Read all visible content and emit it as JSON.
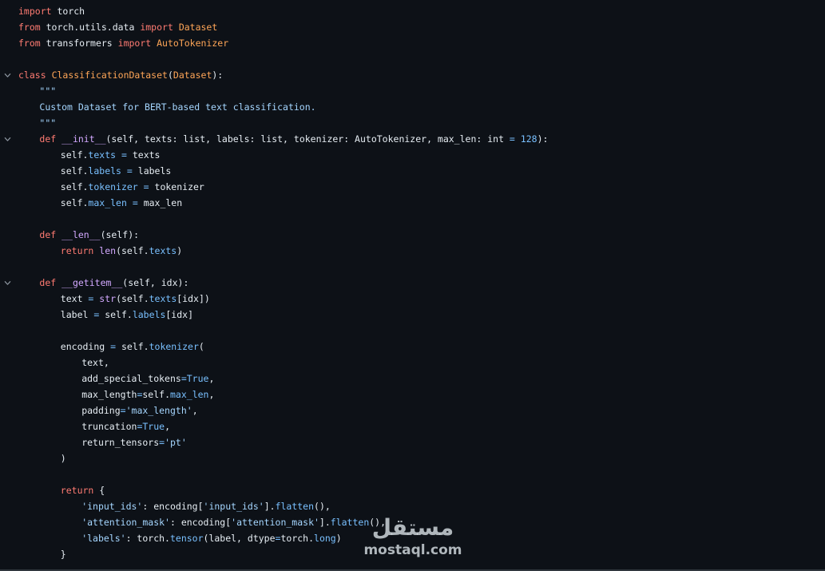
{
  "editor": {
    "lines": [
      {
        "fold": false,
        "indent": 0,
        "tokens": [
          [
            "kw",
            "import"
          ],
          [
            "plain",
            " torch"
          ]
        ]
      },
      {
        "fold": false,
        "indent": 0,
        "tokens": [
          [
            "kw",
            "from"
          ],
          [
            "plain",
            " torch.utils.data "
          ],
          [
            "kw",
            "import"
          ],
          [
            "plain",
            " "
          ],
          [
            "cls",
            "Dataset"
          ]
        ]
      },
      {
        "fold": false,
        "indent": 0,
        "tokens": [
          [
            "kw",
            "from"
          ],
          [
            "plain",
            " transformers "
          ],
          [
            "kw",
            "import"
          ],
          [
            "plain",
            " "
          ],
          [
            "cls",
            "AutoTokenizer"
          ]
        ]
      },
      {
        "fold": false,
        "indent": 0,
        "tokens": []
      },
      {
        "fold": true,
        "indent": 0,
        "tokens": [
          [
            "kw",
            "class"
          ],
          [
            "plain",
            " "
          ],
          [
            "cls",
            "ClassificationDataset"
          ],
          [
            "plain",
            "("
          ],
          [
            "cls",
            "Dataset"
          ],
          [
            "plain",
            "):"
          ]
        ]
      },
      {
        "fold": false,
        "indent": 1,
        "tokens": [
          [
            "str",
            "\"\"\""
          ]
        ]
      },
      {
        "fold": false,
        "indent": 1,
        "tokens": [
          [
            "str",
            "Custom Dataset for BERT-based text classification."
          ]
        ]
      },
      {
        "fold": false,
        "indent": 1,
        "tokens": [
          [
            "str",
            "\"\"\""
          ]
        ]
      },
      {
        "fold": true,
        "indent": 1,
        "tokens": [
          [
            "kw",
            "def"
          ],
          [
            "plain",
            " "
          ],
          [
            "fn",
            "__init__"
          ],
          [
            "plain",
            "(self, texts: list, labels: list, tokenizer: AutoTokenizer, max_len: int "
          ],
          [
            "op",
            "="
          ],
          [
            "plain",
            " "
          ],
          [
            "num",
            "128"
          ],
          [
            "plain",
            "):"
          ]
        ]
      },
      {
        "fold": false,
        "indent": 2,
        "tokens": [
          [
            "plain",
            "self."
          ],
          [
            "attr",
            "texts"
          ],
          [
            "plain",
            " "
          ],
          [
            "op",
            "="
          ],
          [
            "plain",
            " texts"
          ]
        ]
      },
      {
        "fold": false,
        "indent": 2,
        "tokens": [
          [
            "plain",
            "self."
          ],
          [
            "attr",
            "labels"
          ],
          [
            "plain",
            " "
          ],
          [
            "op",
            "="
          ],
          [
            "plain",
            " labels"
          ]
        ]
      },
      {
        "fold": false,
        "indent": 2,
        "tokens": [
          [
            "plain",
            "self."
          ],
          [
            "attr",
            "tokenizer"
          ],
          [
            "plain",
            " "
          ],
          [
            "op",
            "="
          ],
          [
            "plain",
            " tokenizer"
          ]
        ]
      },
      {
        "fold": false,
        "indent": 2,
        "tokens": [
          [
            "plain",
            "self."
          ],
          [
            "attr",
            "max_len"
          ],
          [
            "plain",
            " "
          ],
          [
            "op",
            "="
          ],
          [
            "plain",
            " max_len"
          ]
        ]
      },
      {
        "fold": false,
        "indent": 0,
        "tokens": []
      },
      {
        "fold": false,
        "indent": 1,
        "tokens": [
          [
            "kw",
            "def"
          ],
          [
            "plain",
            " "
          ],
          [
            "fn",
            "__len__"
          ],
          [
            "plain",
            "(self):"
          ]
        ]
      },
      {
        "fold": false,
        "indent": 2,
        "tokens": [
          [
            "kw",
            "return"
          ],
          [
            "plain",
            " "
          ],
          [
            "fn",
            "len"
          ],
          [
            "plain",
            "(self."
          ],
          [
            "attr",
            "texts"
          ],
          [
            "plain",
            ")"
          ]
        ]
      },
      {
        "fold": false,
        "indent": 0,
        "tokens": []
      },
      {
        "fold": true,
        "indent": 1,
        "tokens": [
          [
            "kw",
            "def"
          ],
          [
            "plain",
            " "
          ],
          [
            "fn",
            "__getitem__"
          ],
          [
            "plain",
            "(self, idx):"
          ]
        ]
      },
      {
        "fold": false,
        "indent": 2,
        "tokens": [
          [
            "plain",
            "text "
          ],
          [
            "op",
            "="
          ],
          [
            "plain",
            " "
          ],
          [
            "fn",
            "str"
          ],
          [
            "plain",
            "(self."
          ],
          [
            "attr",
            "texts"
          ],
          [
            "plain",
            "[idx])"
          ]
        ]
      },
      {
        "fold": false,
        "indent": 2,
        "tokens": [
          [
            "plain",
            "label "
          ],
          [
            "op",
            "="
          ],
          [
            "plain",
            " self."
          ],
          [
            "attr",
            "labels"
          ],
          [
            "plain",
            "[idx]"
          ]
        ]
      },
      {
        "fold": false,
        "indent": 0,
        "tokens": []
      },
      {
        "fold": false,
        "indent": 2,
        "tokens": [
          [
            "plain",
            "encoding "
          ],
          [
            "op",
            "="
          ],
          [
            "plain",
            " self."
          ],
          [
            "attr",
            "tokenizer"
          ],
          [
            "plain",
            "("
          ]
        ]
      },
      {
        "fold": false,
        "indent": 3,
        "tokens": [
          [
            "plain",
            "text,"
          ]
        ]
      },
      {
        "fold": false,
        "indent": 3,
        "tokens": [
          [
            "plain",
            "add_special_tokens"
          ],
          [
            "op",
            "="
          ],
          [
            "num",
            "True"
          ],
          [
            "plain",
            ","
          ]
        ]
      },
      {
        "fold": false,
        "indent": 3,
        "tokens": [
          [
            "plain",
            "max_length"
          ],
          [
            "op",
            "="
          ],
          [
            "plain",
            "self."
          ],
          [
            "attr",
            "max_len"
          ],
          [
            "plain",
            ","
          ]
        ]
      },
      {
        "fold": false,
        "indent": 3,
        "tokens": [
          [
            "plain",
            "padding"
          ],
          [
            "op",
            "="
          ],
          [
            "str",
            "'max_length'"
          ],
          [
            "plain",
            ","
          ]
        ]
      },
      {
        "fold": false,
        "indent": 3,
        "tokens": [
          [
            "plain",
            "truncation"
          ],
          [
            "op",
            "="
          ],
          [
            "num",
            "True"
          ],
          [
            "plain",
            ","
          ]
        ]
      },
      {
        "fold": false,
        "indent": 3,
        "tokens": [
          [
            "plain",
            "return_tensors"
          ],
          [
            "op",
            "="
          ],
          [
            "str",
            "'pt'"
          ]
        ]
      },
      {
        "fold": false,
        "indent": 2,
        "tokens": [
          [
            "plain",
            ")"
          ]
        ]
      },
      {
        "fold": false,
        "indent": 0,
        "tokens": []
      },
      {
        "fold": false,
        "indent": 2,
        "tokens": [
          [
            "kw",
            "return"
          ],
          [
            "plain",
            " {"
          ]
        ]
      },
      {
        "fold": false,
        "indent": 3,
        "tokens": [
          [
            "str",
            "'input_ids'"
          ],
          [
            "plain",
            ": encoding["
          ],
          [
            "str",
            "'input_ids'"
          ],
          [
            "plain",
            "]."
          ],
          [
            "attr",
            "flatten"
          ],
          [
            "plain",
            "(),"
          ]
        ]
      },
      {
        "fold": false,
        "indent": 3,
        "tokens": [
          [
            "str",
            "'attention_mask'"
          ],
          [
            "plain",
            ": encoding["
          ],
          [
            "str",
            "'attention_mask'"
          ],
          [
            "plain",
            "]."
          ],
          [
            "attr",
            "flatten"
          ],
          [
            "plain",
            "(),"
          ]
        ]
      },
      {
        "fold": false,
        "indent": 3,
        "tokens": [
          [
            "str",
            "'labels'"
          ],
          [
            "plain",
            ": torch."
          ],
          [
            "attr",
            "tensor"
          ],
          [
            "plain",
            "(label, dtype"
          ],
          [
            "op",
            "="
          ],
          [
            "plain",
            "torch."
          ],
          [
            "attr",
            "long"
          ],
          [
            "plain",
            ")"
          ]
        ]
      },
      {
        "fold": false,
        "indent": 2,
        "tokens": [
          [
            "plain",
            "}"
          ]
        ]
      }
    ]
  },
  "watermark": {
    "arabic": "مستقل",
    "latin": "mostaql.com"
  },
  "colors": {
    "background": "#0d1117",
    "keyword": "#ff7b72",
    "class": "#ffa657",
    "function": "#d2a8ff",
    "string": "#a5d6ff",
    "number": "#79c0ff",
    "text": "#e6edf3"
  },
  "icons": {
    "fold": "chevron-down-icon"
  }
}
